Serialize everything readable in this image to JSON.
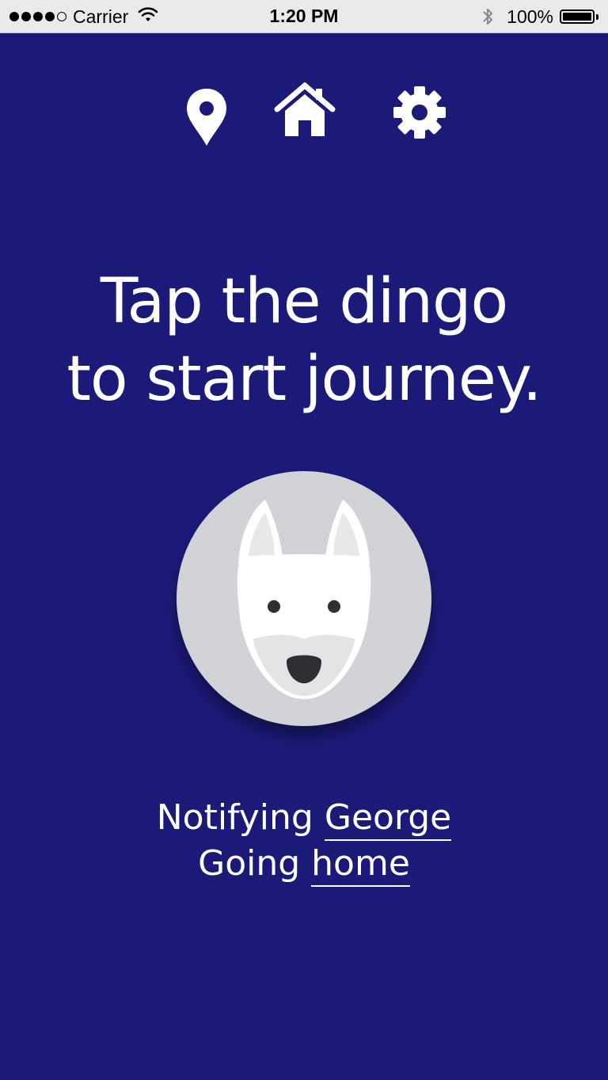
{
  "status_bar": {
    "carrier": "Carrier",
    "time": "1:20 PM",
    "battery_percent": "100%",
    "signal_strength": 4,
    "signal_max": 5
  },
  "nav": {
    "icons": [
      "location-pin-icon",
      "home-icon",
      "settings-gear-icon"
    ]
  },
  "headline": {
    "line1": "Tap the dingo",
    "line2": "to start journey."
  },
  "status": {
    "notify_prefix": "Notifying",
    "contact": "George",
    "going_prefix": "Going",
    "destination": "home"
  },
  "colors": {
    "background": "#1b1a78",
    "button": "#d2d3d7",
    "text": "#ffffff"
  }
}
